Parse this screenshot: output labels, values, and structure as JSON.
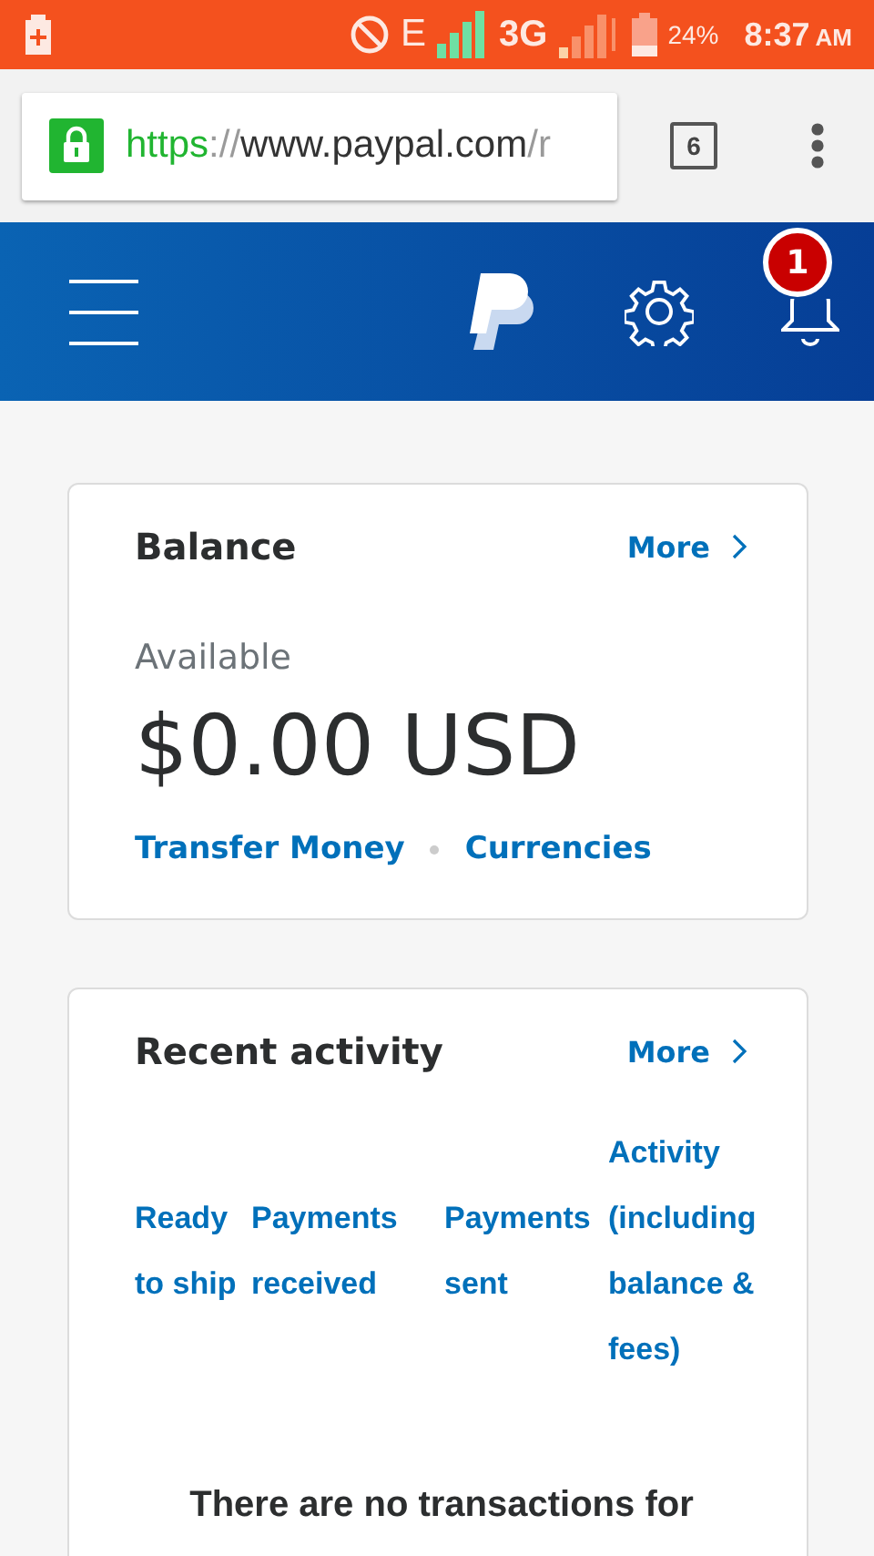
{
  "status_bar": {
    "network_type": "E",
    "data_type": "3G",
    "battery": "24%",
    "time": "8:37",
    "ampm": "AM"
  },
  "browser": {
    "url": [
      {
        "kind": "scheme",
        "text": "https"
      },
      {
        "kind": "dim",
        "text": "://"
      },
      {
        "kind": "host",
        "text": "www.paypal.com"
      },
      {
        "kind": "dim",
        "text": "/r"
      }
    ],
    "tab_count": "6"
  },
  "header": {
    "notification_count": "1"
  },
  "balance": {
    "title": "Balance",
    "more": "More",
    "available_label": "Available",
    "amount": "$0.00 USD",
    "links": [
      "Transfer Money",
      "Currencies"
    ]
  },
  "recent_activity": {
    "title": "Recent activity",
    "more": "More",
    "filters": [
      "Ready to ship",
      "Payments received",
      "Payments sent",
      "Activity(including balance & fees)"
    ],
    "empty_message": "There are no transactions for"
  }
}
